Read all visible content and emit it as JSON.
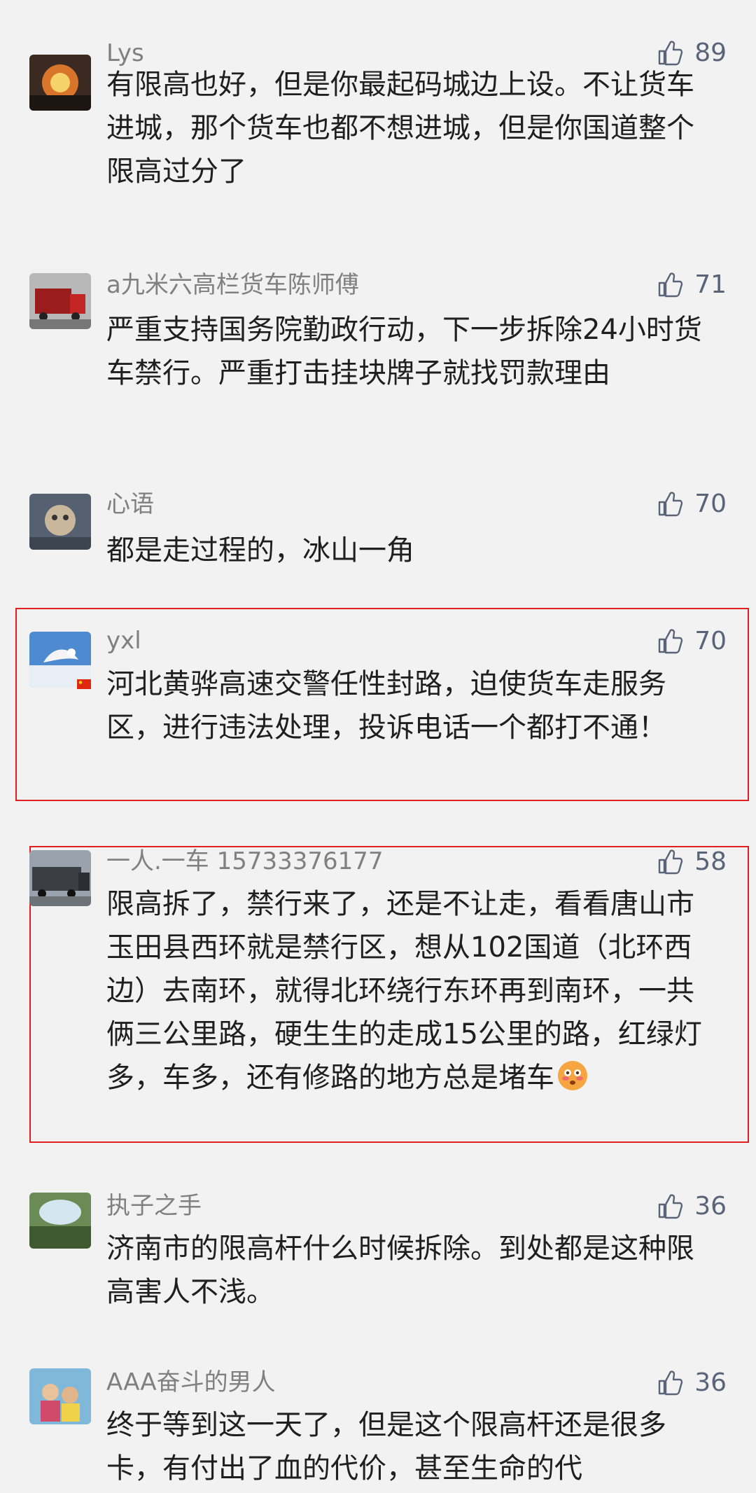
{
  "comments": [
    {
      "username": "Lys",
      "likes": "89",
      "text": "有限高也好，但是你最起码城边上设。不让货车进城，那个货车也都不想进城，但是你国道整个限高过分了"
    },
    {
      "username": "a九米六高栏货车陈师傅",
      "likes": "71",
      "text": "严重支持国务院勤政行动，下一步拆除24小时货车禁行。严重打击挂块牌子就找罚款理由"
    },
    {
      "username": "心语",
      "likes": "70",
      "text": "都是走过程的，冰山一角"
    },
    {
      "username": "yxl",
      "likes": "70",
      "text": "河北黄骅高速交警任性封路，迫使货车走服务区，进行违法处理，投诉电话一个都打不通！"
    },
    {
      "username": "一人.一车 15733376177",
      "likes": "58",
      "text": "限高拆了，禁行来了，还是不让走，看看唐山市玉田县西环就是禁行区，想从102国道（北环西边）去南环，就得北环绕行东环再到南环，一共俩三公里路，硬生生的走成15公里的路，红绿灯多，车多，还有修路的地方总是堵车"
    },
    {
      "username": "执子之手",
      "likes": "36",
      "text": "济南市的限高杆什么时候拆除。到处都是这种限高害人不浅。"
    },
    {
      "username": "AAA奋斗的男人",
      "likes": "36",
      "text": "终于等到这一天了，但是这个限高杆还是很多卡，有付出了血的代价，甚至生命的代"
    }
  ],
  "icons": {
    "like": "thumbs-up-icon",
    "emoji": "flushed-face-emoji-icon",
    "flag": "china-flag-icon"
  },
  "colors": {
    "background": "#f2f2f2",
    "username": "#808080",
    "like": "#5a6478",
    "highlight_border": "#e02020"
  }
}
